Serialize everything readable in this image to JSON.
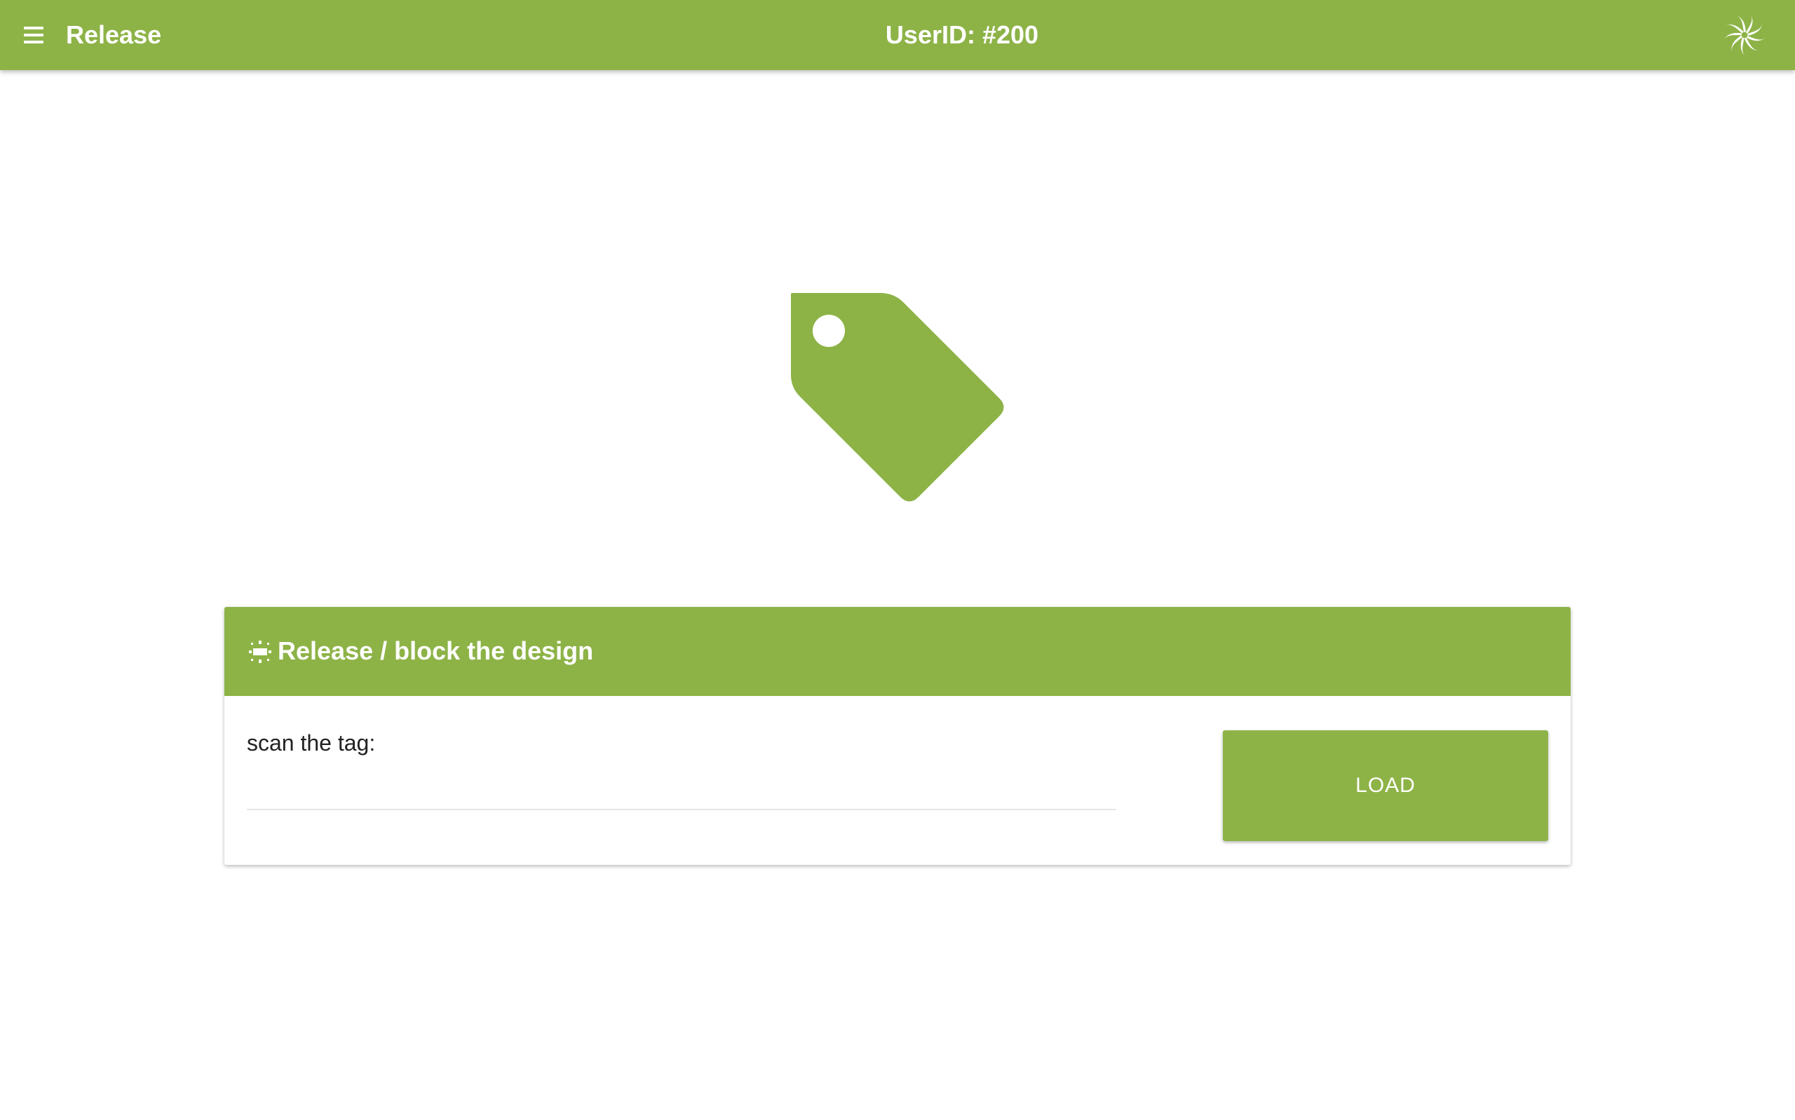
{
  "colors": {
    "accent": "#8db347",
    "text_dark": "#222222",
    "background": "#ffffff"
  },
  "header": {
    "title": "Release",
    "user_id": "UserID: #200",
    "menu_icon": "hamburger-menu-icon",
    "logo_icon": "swirl-logo-icon"
  },
  "hero": {
    "icon": "tag-icon"
  },
  "card": {
    "icon": "sun-icon",
    "title": "Release / block the design",
    "field_label": "scan the tag:",
    "field_value": "",
    "field_placeholder": "",
    "button_label": "LOAD"
  }
}
